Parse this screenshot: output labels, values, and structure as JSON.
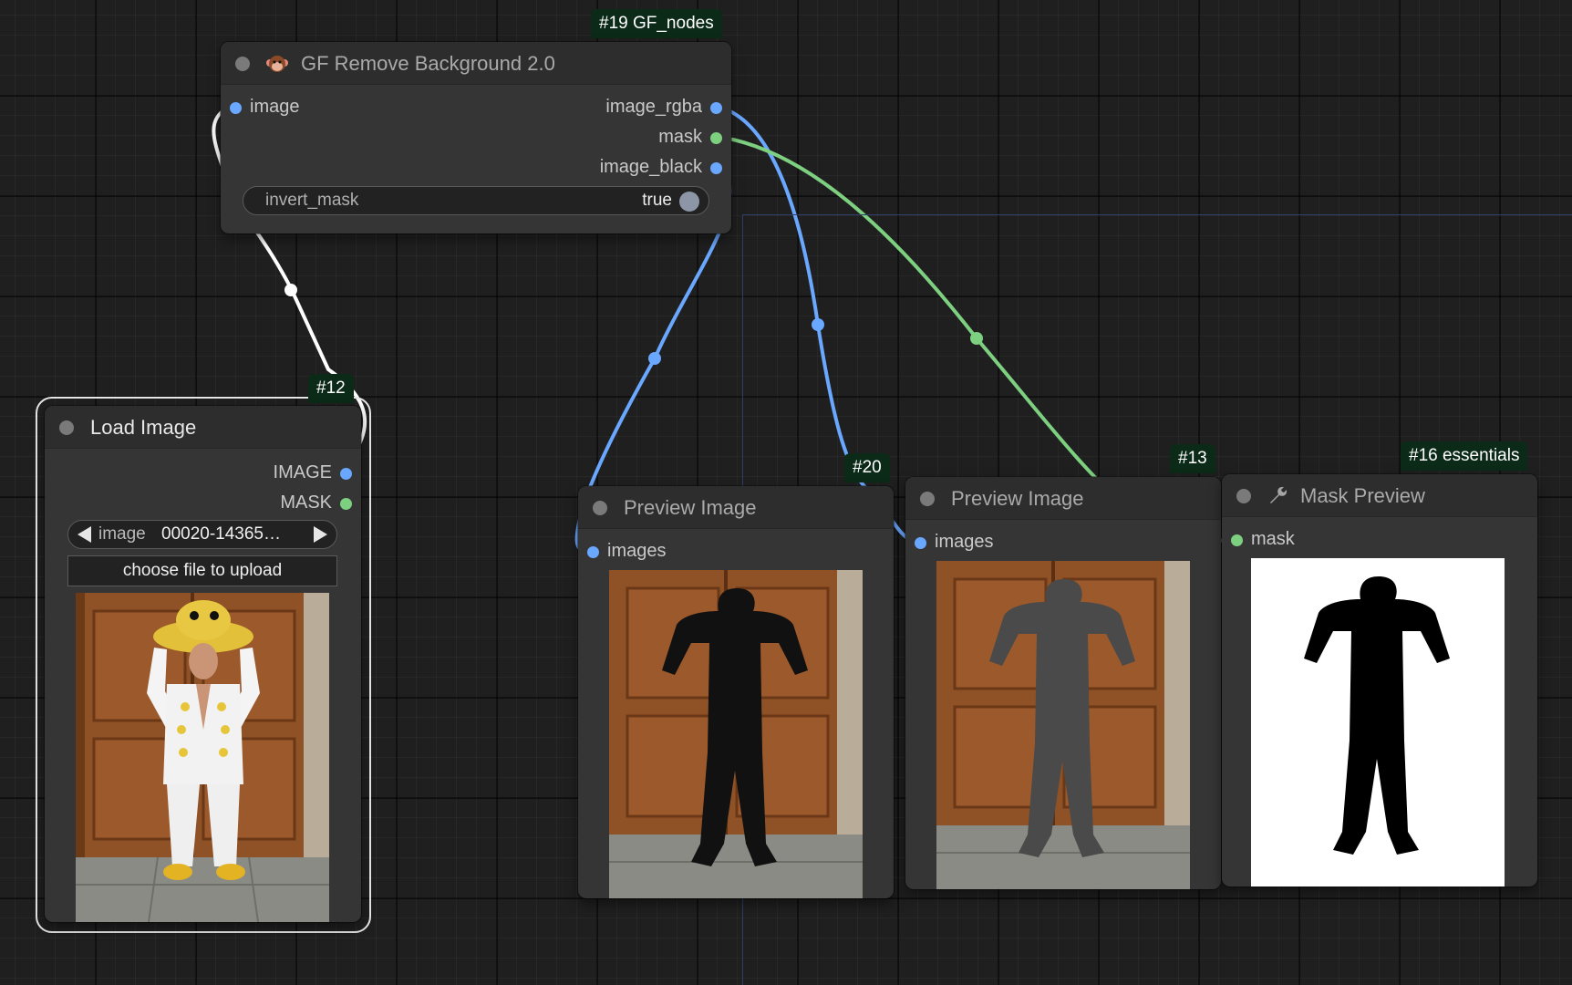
{
  "colors": {
    "image_link": "#6aa7ff",
    "mask_link": "#7ed081",
    "selected_link": "#ffffff",
    "badge_bg": "#0c2a18"
  },
  "nodes": {
    "remove_bg": {
      "badge": "#19 GF_nodes",
      "icon": "monkey-emoji-icon",
      "title": "GF Remove Background 2.0",
      "input_image": "image",
      "output_rgba": "image_rgba",
      "output_mask": "mask",
      "output_black": "image_black",
      "widget_label": "invert_mask",
      "widget_value": "true"
    },
    "load_image": {
      "badge": "#12",
      "title": "Load Image",
      "output_image": "IMAGE",
      "output_mask": "MASK",
      "combo_label": "image",
      "combo_value": "00020-14365…",
      "upload_label": "choose file to upload"
    },
    "preview_20": {
      "badge": "#20",
      "title": "Preview Image",
      "input_images": "images"
    },
    "preview_13": {
      "badge": "#13",
      "title": "Preview Image",
      "input_images": "images"
    },
    "mask_preview": {
      "badge": "#16 essentials",
      "icon": "wrench-icon",
      "title": "Mask Preview",
      "input_mask": "mask"
    }
  }
}
